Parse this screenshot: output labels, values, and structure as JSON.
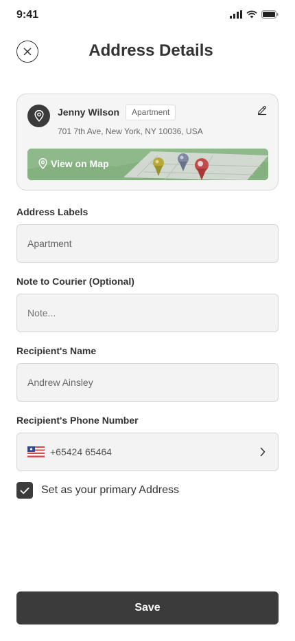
{
  "status_bar": {
    "time": "9:41"
  },
  "header": {
    "title": "Address Details"
  },
  "address_card": {
    "name": "Jenny Wilson",
    "tag": "Apartment",
    "address": "701 7th Ave, New York, NY 10036, USA",
    "map_link": "View on Map"
  },
  "fields": {
    "address_labels": {
      "label": "Address Labels",
      "value": "Apartment"
    },
    "note": {
      "label": "Note to Courier (Optional)",
      "placeholder": "Note..."
    },
    "recipient_name": {
      "label": "Recipient's Name",
      "value": "Andrew Ainsley"
    },
    "recipient_phone": {
      "label": "Recipient's Phone Number",
      "value": "+65424 65464"
    }
  },
  "primary_checkbox": {
    "label": "Set as your primary Address",
    "checked": true
  },
  "save_button": {
    "label": "Save"
  },
  "colors": {
    "primary": "#3b3b3b",
    "field_bg": "#f3f3f3",
    "border": "#d6d6d6"
  }
}
